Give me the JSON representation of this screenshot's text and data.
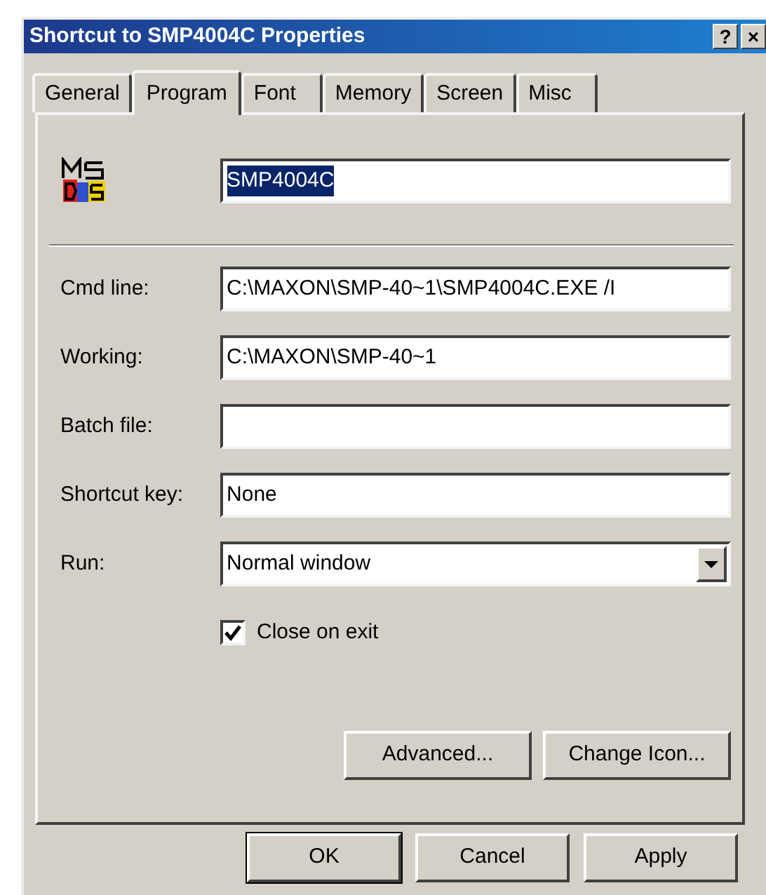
{
  "window": {
    "title": "Shortcut to SMP4004C Properties",
    "title_buttons": [
      "?",
      "×"
    ]
  },
  "tabs": [
    {
      "label": "General",
      "selected": false
    },
    {
      "label": "Program",
      "selected": true
    },
    {
      "label": "Font",
      "selected": false
    },
    {
      "label": "Memory",
      "selected": false
    },
    {
      "label": "Screen",
      "selected": false
    },
    {
      "label": "Misc",
      "selected": false
    }
  ],
  "program_name": {
    "value": "SMP4004C",
    "selected": true
  },
  "fields": [
    {
      "kind": "text",
      "label": "Cmd line:",
      "value": "C:\\MAXON\\SMP-40~1\\SMP4004C.EXE /I"
    },
    {
      "kind": "text",
      "label": "Working:",
      "value": "C:\\MAXON\\SMP-40~1"
    },
    {
      "kind": "text",
      "label": "Batch file:"
    },
    {
      "kind": "text",
      "label": "Shortcut key:",
      "value": "None"
    },
    {
      "kind": "dropdown",
      "label": "Run:",
      "value": "Normal window"
    }
  ],
  "close_on_exit": {
    "label": "Close on exit",
    "checked": true
  },
  "panel_buttons": [
    "Advanced...",
    "Change Icon..."
  ],
  "dialog_buttons": [
    {
      "label": "OK",
      "default": true
    },
    {
      "label": "Cancel",
      "default": false
    },
    {
      "label": "Apply",
      "default": false
    }
  ]
}
